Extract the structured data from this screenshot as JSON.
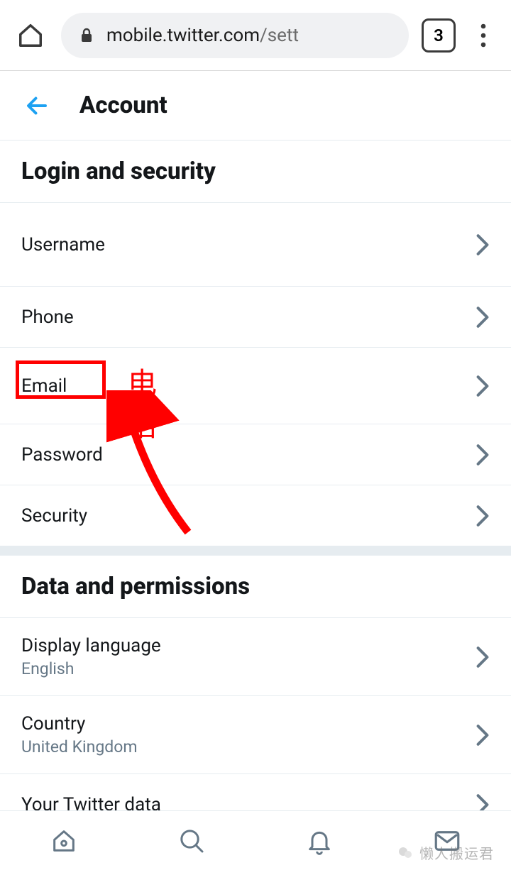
{
  "browser": {
    "url_host": "mobile.twitter.com",
    "url_path": "/sett",
    "tab_count": "3"
  },
  "header": {
    "title": "Account"
  },
  "sections": [
    {
      "title": "Login and security",
      "items": [
        {
          "label": "Username",
          "sub": ""
        },
        {
          "label": "Phone",
          "sub": ""
        },
        {
          "label": "Email",
          "sub": ""
        },
        {
          "label": "Password",
          "sub": ""
        },
        {
          "label": "Security",
          "sub": ""
        }
      ]
    },
    {
      "title": "Data and permissions",
      "items": [
        {
          "label": "Display language",
          "sub": "English"
        },
        {
          "label": "Country",
          "sub": "United Kingdom"
        },
        {
          "label": "Your Twitter data",
          "sub": ""
        }
      ]
    }
  ],
  "annotation": {
    "text": "电话"
  },
  "watermark": {
    "text": "懒人搬运君"
  }
}
